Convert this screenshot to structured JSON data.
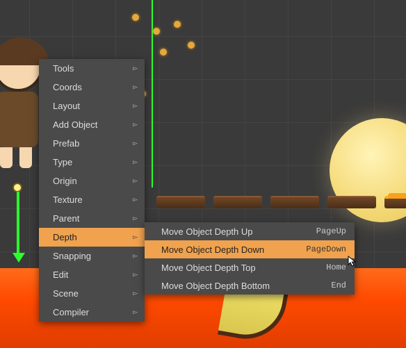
{
  "menu": {
    "items": [
      {
        "label": "Tools"
      },
      {
        "label": "Coords"
      },
      {
        "label": "Layout"
      },
      {
        "label": "Add Object"
      },
      {
        "label": "Prefab"
      },
      {
        "label": "Type"
      },
      {
        "label": "Origin"
      },
      {
        "label": "Texture"
      },
      {
        "label": "Parent"
      },
      {
        "label": "Depth"
      },
      {
        "label": "Snapping"
      },
      {
        "label": "Edit"
      },
      {
        "label": "Scene"
      },
      {
        "label": "Compiler"
      }
    ],
    "highlighted_index": 9
  },
  "submenu": {
    "items": [
      {
        "label": "Move Object Depth Up",
        "shortcut": "PageUp"
      },
      {
        "label": "Move Object Depth Down",
        "shortcut": "PageDown"
      },
      {
        "label": "Move Object Depth Top",
        "shortcut": "Home"
      },
      {
        "label": "Move Object Depth Bottom",
        "shortcut": "End"
      }
    ],
    "highlighted_index": 1
  }
}
